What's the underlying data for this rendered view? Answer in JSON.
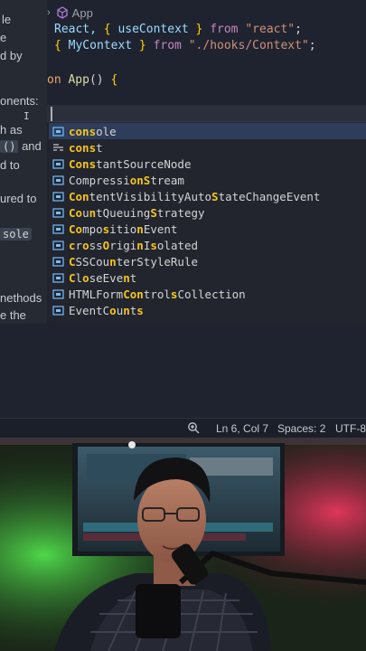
{
  "doc_panel": {
    "lines": [
      "le",
      "e",
      "d by",
      "onents:",
      "h as",
      "()",
      "and",
      "d to",
      "ured to",
      "sole",
      "nethods",
      "e the"
    ]
  },
  "editor": {
    "breadcrumb": {
      "file": "App"
    },
    "code": {
      "line1": {
        "t1": "React, ",
        "t2": "{",
        "t3": " useContext ",
        "t4": "}",
        "t5": " from ",
        "t6": "\"react\"",
        "t7": ";"
      },
      "line2": {
        "t1": "{",
        "t2": " MyContext ",
        "t3": "}",
        "t4": " from ",
        "t5": "\"./hooks/Context\"",
        "t6": ";"
      },
      "line3": {
        "t1": "on ",
        "t2": "App",
        "t3": "() ",
        "t4": "{"
      }
    }
  },
  "suggestions": [
    {
      "hl": "cons",
      "rest": "ole"
    },
    {
      "hl": "cons",
      "rest": "t"
    },
    {
      "hl": "Cons",
      "rest": "tantSourceNode"
    },
    {
      "pre": "Compressi",
      "hl": "onS",
      "rest": "tream"
    },
    {
      "hl": "Con",
      "mid": "tentVisibilityAuto",
      "hl2": "S",
      "rest": "tateChangeEvent"
    },
    {
      "hl": "Co",
      "mid": "u",
      "hl2": "n",
      "mid2": "tQueuing",
      "hl3": "S",
      "rest": "trategy"
    },
    {
      "hl": "Co",
      "mid": "mpo",
      "hl2": "s",
      "mid2": "itio",
      "hl3": "n",
      "rest": "Event"
    },
    {
      "hl": "c",
      "mid": "r",
      "hl2": "o",
      "mid2": "ss",
      "hl3": "O",
      "mid3": "rigi",
      "hl4": "n",
      "mid4": "I",
      "hl5": "s",
      "rest": "olated"
    },
    {
      "hl": "C",
      "mid": "SSCou",
      "hl2": "n",
      "mid2": "terStyleRule",
      "hl3": "",
      "rest": ""
    },
    {
      "hl": "C",
      "mid": "l",
      "hl2": "o",
      "mid2": "seEve",
      "hl3": "n",
      "rest": "t"
    },
    {
      "pre": "HTMLForm",
      "hl": "Con",
      "mid": "trol",
      "hl2": "s",
      "rest": "Collection"
    },
    {
      "pre": "EventC",
      "hl": "o",
      "mid": "u",
      "hl2": "n",
      "mid2": "t",
      "hl3": "s",
      "rest": ""
    }
  ],
  "status_bar": {
    "position": "Ln 6, Col 7",
    "spaces": "Spaces: 2",
    "encoding": "UTF-8"
  },
  "colors": {
    "highlight": "#f5c518",
    "selection": "#2d3d5a",
    "editor_bg": "#1f2330"
  },
  "icons": {
    "breadcrumb": "component-icon",
    "suggest_method": "method-icon",
    "suggest_keyword": "keyword-icon",
    "status_zoom": "zoom-icon"
  }
}
